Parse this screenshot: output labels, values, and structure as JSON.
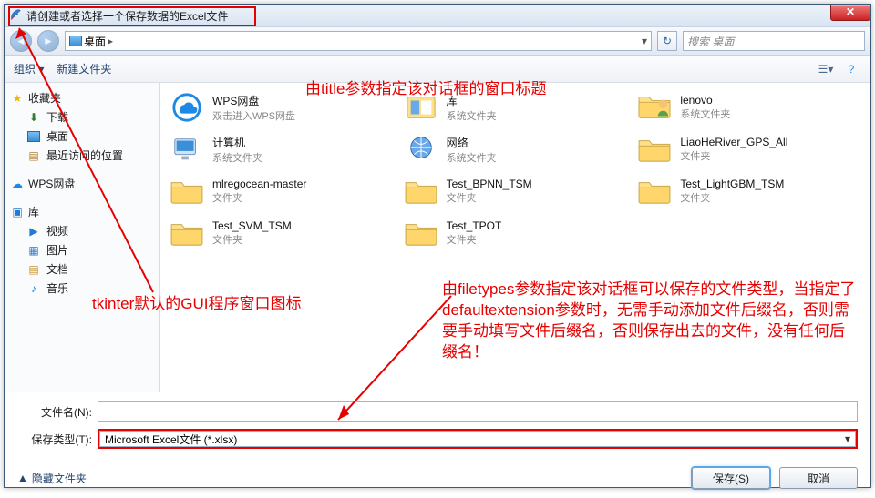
{
  "title": "请创建或者选择一个保存数据的Excel文件",
  "annotations": {
    "top": "由title参数指定该对话框的窗口标题",
    "left": "tkinter默认的GUI程序窗口图标",
    "right": "由filetypes参数指定该对话框可以保存的文件类型，当指定了defaultextension参数时，无需手动添加文件后缀名，否则需要手动填写文件后缀名，否则保存出去的文件，没有任何后缀名！"
  },
  "nav": {
    "path_segment": "桌面",
    "search_placeholder": "搜索 桌面"
  },
  "toolbar": {
    "organize": "组织 ▾",
    "newfolder": "新建文件夹"
  },
  "sidebar": {
    "favorites": {
      "label": "收藏夹",
      "items": [
        "下载",
        "桌面",
        "最近访问的位置"
      ]
    },
    "wps": "WPS网盘",
    "library": {
      "label": "库",
      "items": [
        "视频",
        "图片",
        "文档",
        "音乐"
      ]
    }
  },
  "items": [
    {
      "name": "WPS网盘",
      "sub": "双击进入WPS网盘",
      "kind": "cloud"
    },
    {
      "name": "库",
      "sub": "系统文件夹",
      "kind": "lib"
    },
    {
      "name": "lenovo",
      "sub": "系统文件夹",
      "kind": "user"
    },
    {
      "name": "计算机",
      "sub": "系统文件夹",
      "kind": "pc"
    },
    {
      "name": "网络",
      "sub": "系统文件夹",
      "kind": "net"
    },
    {
      "name": "LiaoHeRiver_GPS_All",
      "sub": "文件夹",
      "kind": "folder"
    },
    {
      "name": "mlregocean-master",
      "sub": "文件夹",
      "kind": "folder"
    },
    {
      "name": "Test_BPNN_TSM",
      "sub": "文件夹",
      "kind": "folder"
    },
    {
      "name": "Test_LightGBM_TSM",
      "sub": "文件夹",
      "kind": "folder"
    },
    {
      "name": "Test_SVM_TSM",
      "sub": "文件夹",
      "kind": "folder"
    },
    {
      "name": "Test_TPOT",
      "sub": "文件夹",
      "kind": "folder"
    }
  ],
  "filename_label": "文件名(N):",
  "filetype_label": "保存类型(T):",
  "filetype_value": "Microsoft Excel文件 (*.xlsx)",
  "hide_folders": "隐藏文件夹",
  "save": "保存(S)",
  "cancel": "取消"
}
